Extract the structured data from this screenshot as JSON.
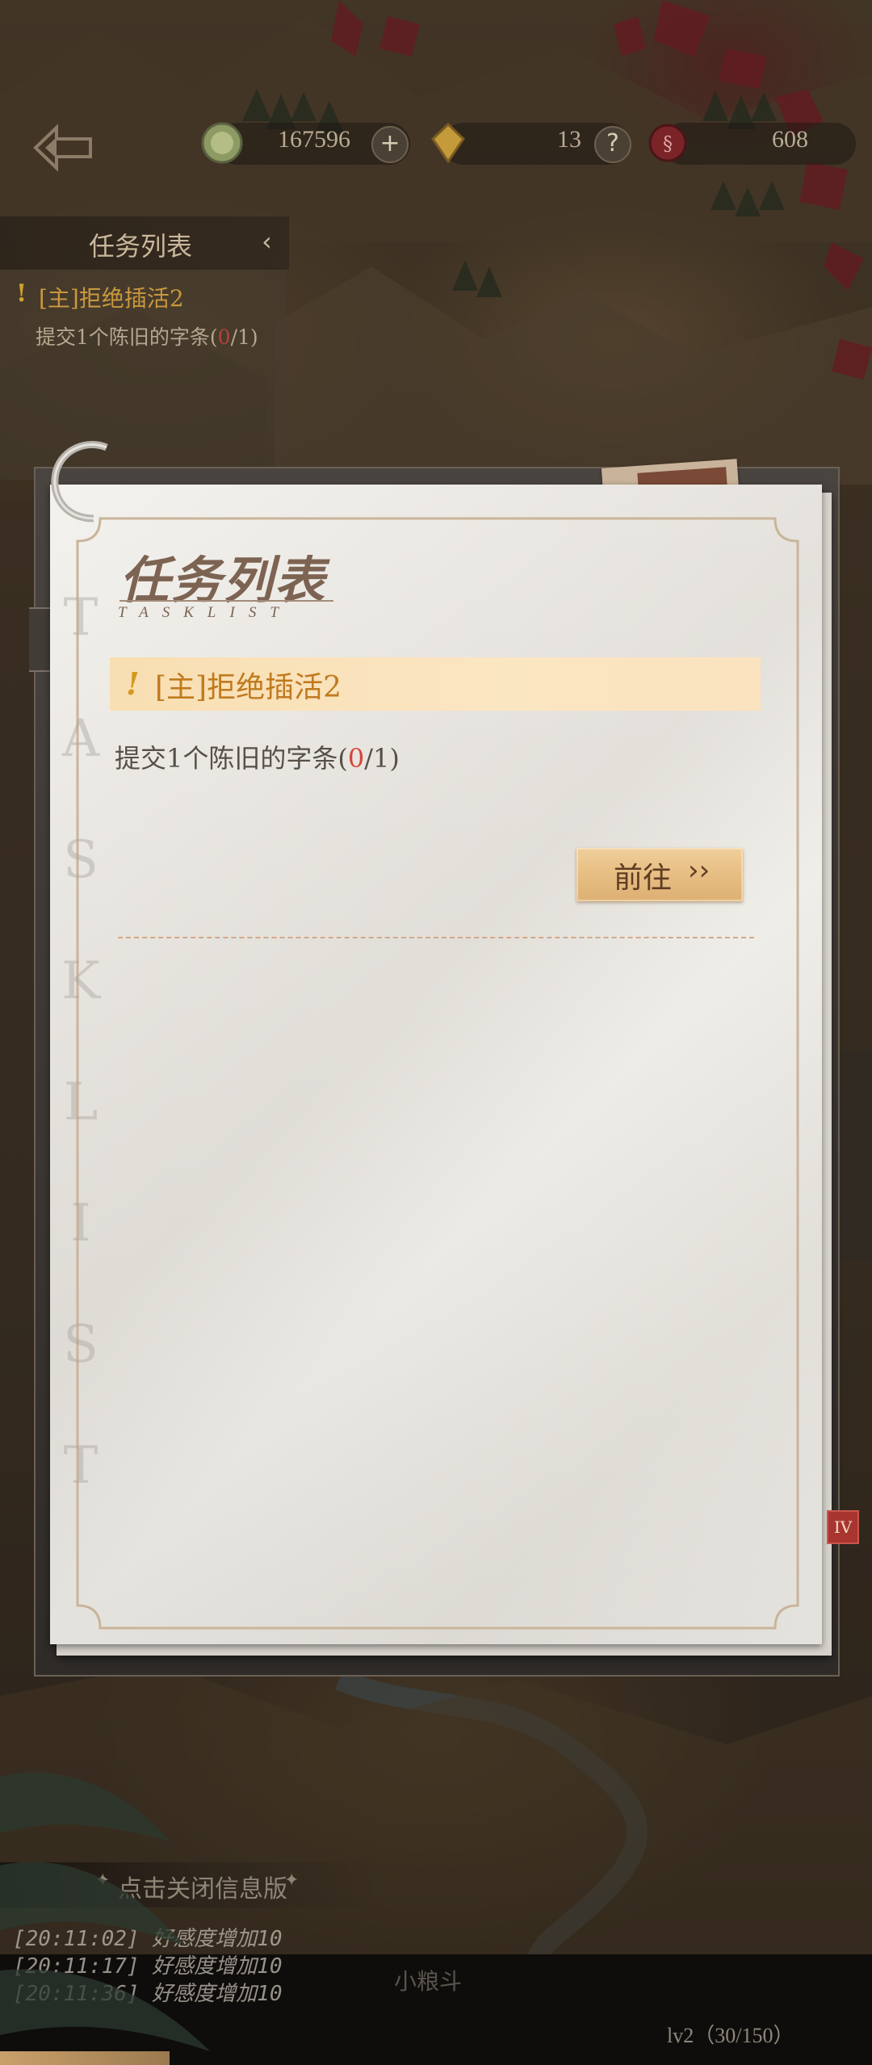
{
  "resources": {
    "coins": "167596",
    "gems": "13",
    "third": "608"
  },
  "side_panel": {
    "title": "任务列表",
    "collapse_glyph": "‹",
    "quest_mark": "!",
    "quest_title": "[主]拒绝插活2",
    "quest_desc_prefix": "提交1个陈旧的字条(",
    "quest_progress_current": "0",
    "quest_desc_suffix": "/1)"
  },
  "notebook": {
    "title_cn": "任务列表",
    "title_en": "TASKLIST",
    "side_letters": [
      "T",
      "A",
      "S",
      "K",
      "L",
      "I",
      "S",
      "T"
    ],
    "quest_mark": "!",
    "quest_title": "[主]拒绝插活2",
    "quest_desc_prefix": "提交1个陈旧的字条(",
    "quest_progress_current": "0",
    "quest_desc_suffix": "/1)",
    "go_button_label": "前往",
    "go_button_arrow": "››"
  },
  "badge": {
    "roman": "IV"
  },
  "info_log": {
    "header": "点击关闭信息版",
    "lines": [
      "[20:11:02] 好感度增加10",
      "[20:11:17] 好感度增加10",
      "[20:11:36] 好感度增加10"
    ],
    "footer_name": "小粮斗"
  },
  "level": {
    "text": "lv2（30/150）"
  },
  "icons": {
    "back": "back-arrow-icon",
    "coin": "coin-icon",
    "gem": "gem-icon",
    "token": "token-icon",
    "plus": "plus-icon",
    "help": "help-icon",
    "ring": "binder-ring-icon"
  },
  "colors": {
    "quest_title": "#c07a1e",
    "progress_red": "#d8453a",
    "go_button": "#e8bf84",
    "badge": "#a8352f"
  }
}
